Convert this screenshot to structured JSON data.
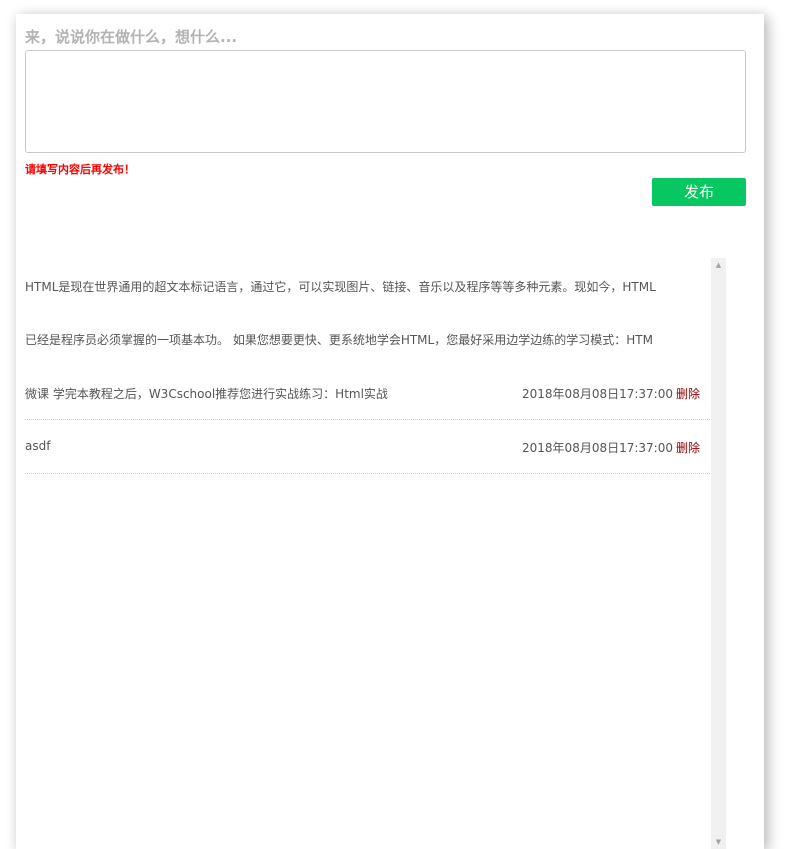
{
  "composer": {
    "prompt": "来，说说你在做什么，想什么...",
    "textarea_value": "",
    "warning": "请填写内容后再发布！",
    "publish_label": "发布"
  },
  "posts": {
    "lines": [
      "HTML是现在世界通用的超文本标记语言，通过它，可以实现图片、链接、音乐以及程序等等多种元素。现如今，HTML",
      "已经是程序员必须掌握的一项基本功。 如果您想要更快、更系统地学会HTML，您最好采用边学边练的学习模式：HTM"
    ],
    "items": [
      {
        "text": "微课 学完本教程之后，W3Cschool推荐您进行实战练习：Html实战",
        "time": "2018年08月08日17:37:00",
        "delete_label": "删除"
      },
      {
        "text": "asdf",
        "time": "2018年08月08日17:37:00",
        "delete_label": "删除"
      }
    ]
  },
  "scrollbar": {
    "up_icon": "scroll-up-arrow-icon",
    "down_icon": "scroll-down-arrow-icon"
  },
  "colors": {
    "publish_button": "#07c860",
    "warning": "#ff0000",
    "delete_link": "#8b0000",
    "prompt": "#b3b3b3"
  }
}
